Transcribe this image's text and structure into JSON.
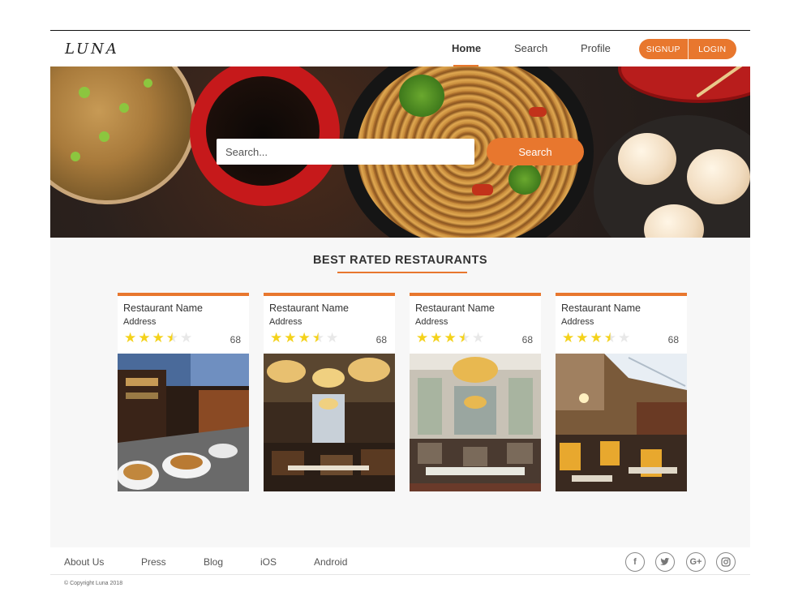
{
  "header": {
    "logo": "LUNA",
    "nav": {
      "home": "Home",
      "search": "Search",
      "profile": "Profile"
    },
    "signup": "SIGNUP",
    "login": "LOGIN"
  },
  "hero": {
    "search_placeholder": "Search...",
    "search_button": "Search"
  },
  "section_title": "BEST RATED RESTAURANTS",
  "restaurants": [
    {
      "name": "Restaurant Name",
      "address": "Address",
      "rating": 3.5,
      "count": "68"
    },
    {
      "name": "Restaurant Name",
      "address": "Address",
      "rating": 3.5,
      "count": "68"
    },
    {
      "name": "Restaurant Name",
      "address": "Address",
      "rating": 3.5,
      "count": "68"
    },
    {
      "name": "Restaurant Name",
      "address": "Address",
      "rating": 3.5,
      "count": "68"
    }
  ],
  "footer": {
    "links": [
      "About Us",
      "Press",
      "Blog",
      "iOS",
      "Android"
    ],
    "copyright": "© Copyright Luna 2018",
    "social": [
      "facebook-icon",
      "twitter-icon",
      "google-plus-icon",
      "instagram-icon"
    ]
  },
  "colors": {
    "accent": "#e8772e",
    "star": "#f4d21b"
  }
}
